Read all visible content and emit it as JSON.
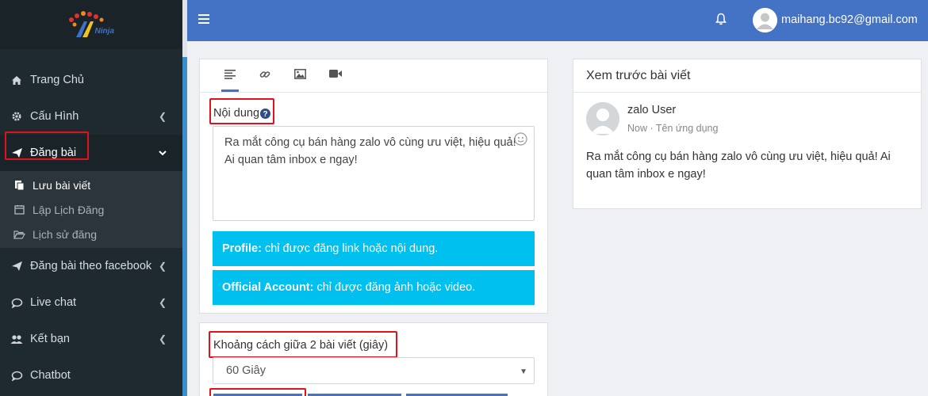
{
  "sidebar": {
    "logo_text": "Ninja",
    "items": [
      {
        "label": "Trang Chủ"
      },
      {
        "label": "Cấu Hình"
      },
      {
        "label": "Đăng bài"
      },
      {
        "label": "Đăng bài theo facebook"
      },
      {
        "label": "Live chat"
      },
      {
        "label": "Kết bạn"
      },
      {
        "label": "Chatbot"
      }
    ],
    "submenu": [
      {
        "label": "Lưu bài viết"
      },
      {
        "label": "Lập Lịch Đăng"
      },
      {
        "label": "Lịch sử đăng"
      }
    ]
  },
  "topbar": {
    "user_email": "maihang.bc92@gmail.com"
  },
  "editor": {
    "content_label": "Nội dung",
    "content_text": "Ra mắt công cụ bán hàng zalo vô cùng ưu việt, hiệu quả! Ai quan tâm inbox e ngay!",
    "info_profile_bold": "Profile:",
    "info_profile_text": "chỉ được đăng link hoặc nội dung.",
    "info_official_bold": "Official Account:",
    "info_official_text": "chỉ được đăng ảnh hoặc video."
  },
  "interval": {
    "label": "Khoảng cách giữa 2 bài viết (giây)",
    "selected": "60 Giây"
  },
  "preview": {
    "title": "Xem trước bài viết",
    "user_name": "zalo User",
    "meta": "Now · Tên ứng dụng",
    "body": "Ra mắt công cụ bán hàng zalo vô cùng ưu việt, hiệu quả! Ai quan tâm inbox e ngay!"
  },
  "colors": {
    "accent": "#4472c4",
    "info": "#00c0ef",
    "sidebar": "#1f2a30",
    "highlight": "#e0121b"
  }
}
